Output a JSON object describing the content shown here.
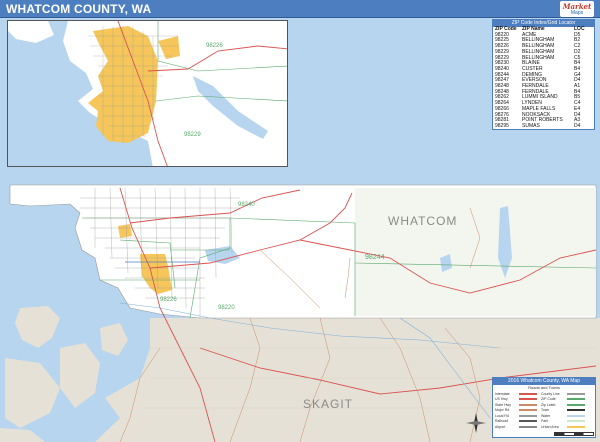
{
  "header": {
    "title": "WHATCOM COUNTY, WA"
  },
  "logo": {
    "line1": "Market",
    "line2": "Maps"
  },
  "colors": {
    "header": "#4d7ebf",
    "water": "#b7d5ee",
    "land_outside": "#e6e1d6",
    "county": "#ffffff",
    "urban": "#f6c65a",
    "zip_border": "#58a86b",
    "highway": "#d9534f"
  },
  "inset": {
    "zip_labels": [
      "98226",
      "98229"
    ]
  },
  "locator": {
    "title": "ZIP Code Index/Grid Locator",
    "headers": [
      "ZIP Code",
      "ZIP Name",
      "LOC"
    ],
    "rows": [
      [
        "98220",
        "ACME",
        "D5"
      ],
      [
        "98225",
        "BELLINGHAM",
        "B2"
      ],
      [
        "98226",
        "BELLINGHAM",
        "C2"
      ],
      [
        "98229",
        "BELLINGHAM",
        "D2"
      ],
      [
        "98229",
        "BELLINGHAM",
        "C5"
      ],
      [
        "98230",
        "BLAINE",
        "B4"
      ],
      [
        "98240",
        "CUSTER",
        "B4"
      ],
      [
        "98244",
        "DEMING",
        "G4"
      ],
      [
        "98247",
        "EVERSON",
        "D4"
      ],
      [
        "98248",
        "FERNDALE",
        "A1"
      ],
      [
        "98248",
        "FERNDALE",
        "B4"
      ],
      [
        "98262",
        "LUMMI ISLAND",
        "B5"
      ],
      [
        "98264",
        "LYNDEN",
        "C4"
      ],
      [
        "98266",
        "MAPLE FALLS",
        "E4"
      ],
      [
        "98276",
        "NOOKSACK",
        "D4"
      ],
      [
        "98281",
        "POINT ROBERTS",
        "A3"
      ],
      [
        "98295",
        "SUMAS",
        "D4"
      ]
    ]
  },
  "map": {
    "county_label": "WHATCOM",
    "neighbor_label": "SKAGIT",
    "zip_labels": [
      "98240",
      "98244",
      "98226",
      "98220"
    ]
  },
  "legend": {
    "title": "2016 Whatcom County, WA Map",
    "subtitle": "Roads and Towns",
    "rows": [
      {
        "left": "Interstate",
        "right": "County Line"
      },
      {
        "left": "US Hwy",
        "right": "ZIP Code"
      },
      {
        "left": "State Hwy",
        "right": "Zip Label"
      },
      {
        "left": "Major Rd",
        "right": "Town"
      },
      {
        "left": "Local Rd",
        "right": "Water"
      },
      {
        "left": "Railroad",
        "right": "Park"
      },
      {
        "left": "Airport",
        "right": "Urban Area"
      }
    ]
  }
}
